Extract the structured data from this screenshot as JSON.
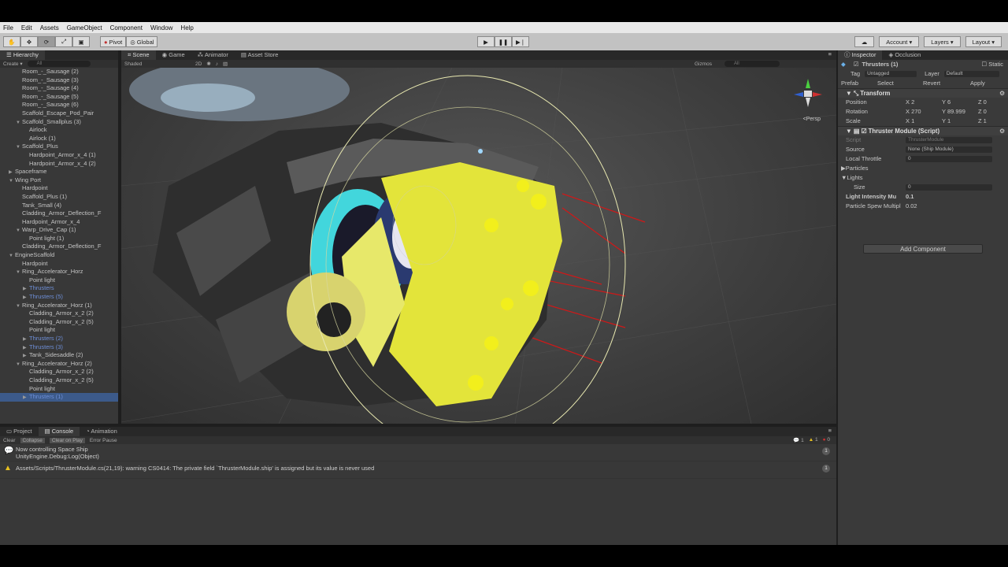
{
  "menu": [
    "File",
    "Edit",
    "Assets",
    "GameObject",
    "Component",
    "Window",
    "Help"
  ],
  "toolbar": {
    "pivot": "Pivot",
    "global": "Global",
    "account": "Account",
    "layers": "Layers",
    "layout": "Layout"
  },
  "hierarchy": {
    "tab": "Hierarchy",
    "create": "Create",
    "search_placeholder": "All",
    "items": [
      {
        "label": "Room_-_Sausage (2)",
        "indent": 2,
        "arrow": "",
        "type": "normal"
      },
      {
        "label": "Room_-_Sausage (3)",
        "indent": 2,
        "arrow": "",
        "type": "normal"
      },
      {
        "label": "Room_-_Sausage (4)",
        "indent": 2,
        "arrow": "",
        "type": "normal"
      },
      {
        "label": "Room_-_Sausage (5)",
        "indent": 2,
        "arrow": "",
        "type": "normal"
      },
      {
        "label": "Room_-_Sausage (6)",
        "indent": 2,
        "arrow": "",
        "type": "normal"
      },
      {
        "label": "Scaffold_Escape_Pod_Pair",
        "indent": 2,
        "arrow": "",
        "type": "normal"
      },
      {
        "label": "Scaffold_Smallplus (3)",
        "indent": 2,
        "arrow": "▼",
        "type": "normal"
      },
      {
        "label": "Airlock",
        "indent": 3,
        "arrow": "",
        "type": "normal"
      },
      {
        "label": "Airlock (1)",
        "indent": 3,
        "arrow": "",
        "type": "normal"
      },
      {
        "label": "Scaffold_Plus",
        "indent": 2,
        "arrow": "▼",
        "type": "normal"
      },
      {
        "label": "Hardpoint_Armor_x_4 (1)",
        "indent": 3,
        "arrow": "",
        "type": "normal"
      },
      {
        "label": "Hardpoint_Armor_x_4 (2)",
        "indent": 3,
        "arrow": "",
        "type": "normal"
      },
      {
        "label": "Spaceframe",
        "indent": 1,
        "arrow": "▶",
        "type": "normal"
      },
      {
        "label": "Wing Port",
        "indent": 1,
        "arrow": "▼",
        "type": "normal"
      },
      {
        "label": "Hardpoint",
        "indent": 2,
        "arrow": "",
        "type": "normal"
      },
      {
        "label": "Scaffold_Plus (1)",
        "indent": 2,
        "arrow": "",
        "type": "normal"
      },
      {
        "label": "Tank_Small (4)",
        "indent": 2,
        "arrow": "",
        "type": "normal"
      },
      {
        "label": "Cladding_Armor_Deflection_F",
        "indent": 2,
        "arrow": "",
        "type": "normal"
      },
      {
        "label": "Hardpoint_Armor_x_4",
        "indent": 2,
        "arrow": "",
        "type": "normal"
      },
      {
        "label": "Warp_Drive_Cap (1)",
        "indent": 2,
        "arrow": "▼",
        "type": "normal"
      },
      {
        "label": "Point light (1)",
        "indent": 3,
        "arrow": "",
        "type": "normal"
      },
      {
        "label": "Cladding_Armor_Deflection_F",
        "indent": 2,
        "arrow": "",
        "type": "normal"
      },
      {
        "label": "EngineScaffold",
        "indent": 1,
        "arrow": "▼",
        "type": "normal"
      },
      {
        "label": "Hardpoint",
        "indent": 2,
        "arrow": "",
        "type": "normal"
      },
      {
        "label": "Ring_Accelerator_Horz",
        "indent": 2,
        "arrow": "▼",
        "type": "normal"
      },
      {
        "label": "Point light",
        "indent": 3,
        "arrow": "",
        "type": "normal"
      },
      {
        "label": "Thrusters",
        "indent": 3,
        "arrow": "▶",
        "type": "prefab"
      },
      {
        "label": "Thrusters (5)",
        "indent": 3,
        "arrow": "▶",
        "type": "prefab"
      },
      {
        "label": "Ring_Accelerator_Horz (1)",
        "indent": 2,
        "arrow": "▼",
        "type": "normal"
      },
      {
        "label": "Cladding_Armor_x_2 (2)",
        "indent": 3,
        "arrow": "",
        "type": "normal"
      },
      {
        "label": "Cladding_Armor_x_2 (5)",
        "indent": 3,
        "arrow": "",
        "type": "normal"
      },
      {
        "label": "Point light",
        "indent": 3,
        "arrow": "",
        "type": "normal"
      },
      {
        "label": "Thrusters (2)",
        "indent": 3,
        "arrow": "▶",
        "type": "prefab"
      },
      {
        "label": "Thrusters (3)",
        "indent": 3,
        "arrow": "▶",
        "type": "prefab"
      },
      {
        "label": "Tank_Sidesaddle (2)",
        "indent": 3,
        "arrow": "▶",
        "type": "normal"
      },
      {
        "label": "Ring_Accelerator_Horz (2)",
        "indent": 2,
        "arrow": "▼",
        "type": "normal"
      },
      {
        "label": "Cladding_Armor_x_2 (2)",
        "indent": 3,
        "arrow": "",
        "type": "normal"
      },
      {
        "label": "Cladding_Armor_x_2 (5)",
        "indent": 3,
        "arrow": "",
        "type": "normal"
      },
      {
        "label": "Point light",
        "indent": 3,
        "arrow": "",
        "type": "normal"
      },
      {
        "label": "Thrusters (1)",
        "indent": 3,
        "arrow": "▶",
        "type": "selected"
      }
    ]
  },
  "scene": {
    "tabs": [
      "Scene",
      "Game",
      "Animator",
      "Asset Store"
    ],
    "shading": "Shaded",
    "mode_2d": "2D",
    "gizmos": "Gizmos",
    "search_placeholder": "All",
    "persp": "Persp"
  },
  "inspector": {
    "tabs": [
      "Inspector",
      "Occlusion"
    ],
    "object_name": "Thrusters (1)",
    "static": "Static",
    "tag_label": "Tag",
    "tag_value": "Untagged",
    "layer_label": "Layer",
    "layer_value": "Default",
    "prefab_label": "Prefab",
    "prefab_select": "Select",
    "prefab_revert": "Revert",
    "prefab_apply": "Apply",
    "transform": {
      "title": "Transform",
      "position": {
        "label": "Position",
        "x": "X 2",
        "y": "Y 6",
        "z": "Z 0"
      },
      "rotation": {
        "label": "Rotation",
        "x": "X 270",
        "y": "Y 89.999",
        "z": "Z 0"
      },
      "scale": {
        "label": "Scale",
        "x": "X 1",
        "y": "Y 1",
        "z": "Z 1"
      }
    },
    "script": {
      "title": "Thruster Module (Script)",
      "script_label": "Script",
      "script_value": "ThrusterModule",
      "source_label": "Source",
      "source_value": "None (Ship Module)",
      "throttle_label": "Local Throttle",
      "throttle_value": "0",
      "particles_label": "Particles",
      "lights_label": "Lights",
      "size_label": "Size",
      "size_value": "0",
      "light_intensity_label": "Light Intensity Mu",
      "light_intensity_value": "0.1",
      "particle_spew_label": "Particle Spew Multipl",
      "particle_spew_value": "0.02"
    },
    "add_component": "Add Component"
  },
  "console": {
    "tabs": [
      "Project",
      "Console",
      "Animation"
    ],
    "buttons": [
      "Clear",
      "Collapse",
      "Clear on Play",
      "Error Pause"
    ],
    "info_count": "1",
    "warn_count": "1",
    "error_count": "0",
    "logs": [
      {
        "line1": "Now controlling Space Ship",
        "line2": "UnityEngine.Debug:Log(Object)",
        "count": "1",
        "level": "info"
      },
      {
        "line1": "Assets/Scripts/ThrusterModule.cs(21,19): warning CS0414: The private field `ThrusterModule.ship' is assigned but its value is never used",
        "line2": "",
        "count": "1",
        "level": "warning"
      }
    ]
  },
  "colors": {
    "editor_bg": "#383838",
    "prefab_blue": "#6e8fd8",
    "selection": "#3c5a8a",
    "engine_yellow": "#e8e83a",
    "ring_cyan": "#4fe0e6",
    "laser_red": "#d01818"
  }
}
